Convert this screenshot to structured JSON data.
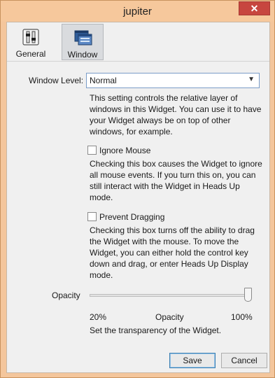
{
  "window": {
    "title": "jupiter",
    "close_glyph": "✕"
  },
  "toolbar": {
    "items": [
      {
        "label": "General",
        "icon": "switches-icon",
        "selected": false
      },
      {
        "label": "Window",
        "icon": "window-layers-icon",
        "selected": true
      }
    ]
  },
  "window_level": {
    "label": "Window Level:",
    "value": "Normal",
    "description": "This setting controls the relative layer of windows in this Widget. You can use it to have your Widget always be on top of other windows, for example."
  },
  "ignore_mouse": {
    "label": "Ignore Mouse",
    "checked": false,
    "description": "Checking this box causes the Widget to ignore all mouse events. If you turn this on, you can still interact with the Widget in Heads Up mode."
  },
  "prevent_dragging": {
    "label": "Prevent Dragging",
    "checked": false,
    "description": "Checking this box turns off the ability to drag the Widget with the mouse. To move the Widget, you can either hold the control key down and drag, or enter Heads Up Display mode."
  },
  "opacity": {
    "label": "Opacity",
    "value_percent": 100,
    "min_label": "20%",
    "mid_label": "Opacity",
    "max_label": "100%",
    "description": "Set the transparency of the Widget."
  },
  "buttons": {
    "save": "Save",
    "cancel": "Cancel"
  },
  "colors": {
    "titlebar": "#f6c89c",
    "close": "#c7463f",
    "client": "#f0f0f0"
  }
}
